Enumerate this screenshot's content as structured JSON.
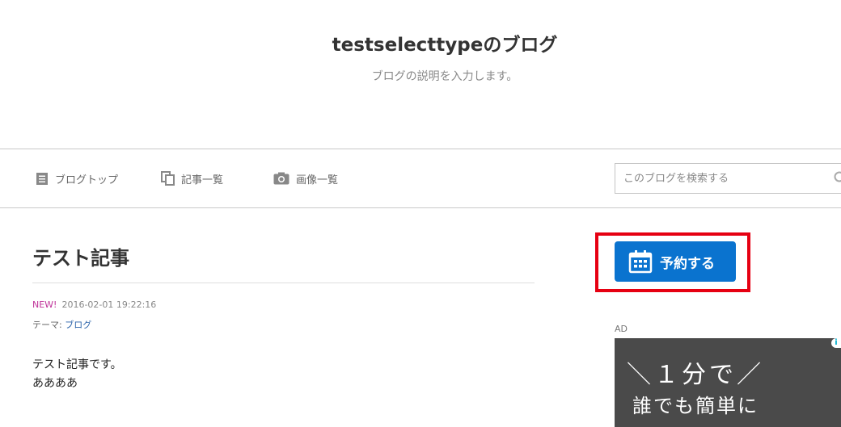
{
  "header": {
    "title": "testselecttypeのブログ",
    "description": "ブログの説明を入力します。"
  },
  "nav": {
    "items": [
      {
        "label": "ブログトップ",
        "icon": "document-icon"
      },
      {
        "label": "記事一覧",
        "icon": "copy-icon"
      },
      {
        "label": "画像一覧",
        "icon": "camera-icon"
      }
    ],
    "search": {
      "placeholder": "このブログを検索する",
      "value": "",
      "icon": "search-icon"
    }
  },
  "article": {
    "title": "テスト記事",
    "new_badge": "NEW!",
    "date": "2016-02-01 19:22:16",
    "theme_label": "テーマ:",
    "theme_value": "ブログ",
    "body_lines": [
      "テスト記事です。",
      "ああああ"
    ]
  },
  "sidebar": {
    "reserve_label": "予約する",
    "reserve_icon": "calendar-icon",
    "ad_label": "AD",
    "ad_line1": "＼１分で／",
    "ad_line2": "誰でも簡単に",
    "ad_info": "i"
  },
  "colors": {
    "reserve_button": "#0a73cf",
    "highlight_frame": "#e60012",
    "new_badge": "#c0359a",
    "theme_link": "#2a62a9",
    "ad_background": "#4a4a4a"
  }
}
